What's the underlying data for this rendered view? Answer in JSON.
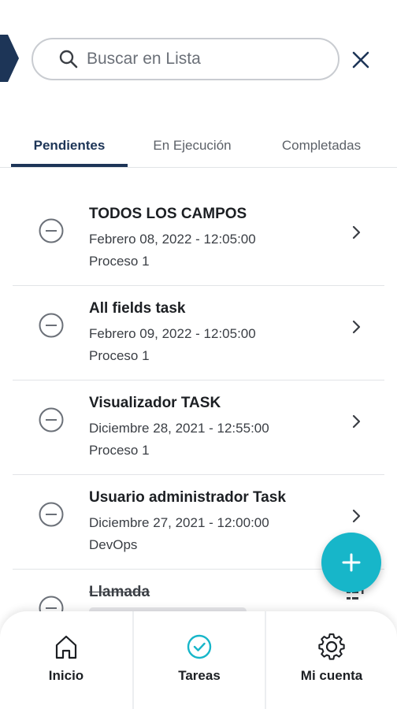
{
  "search": {
    "placeholder": "Buscar en Lista"
  },
  "tabs": [
    {
      "label": "Pendientes",
      "active": true
    },
    {
      "label": "En Ejecución",
      "active": false
    },
    {
      "label": "Completadas",
      "active": false
    }
  ],
  "tasks": [
    {
      "title": "TODOS LOS CAMPOS",
      "date": "Febrero 08, 2022 - 12:05:00",
      "process": "Proceso 1"
    },
    {
      "title": "All fields task",
      "date": "Febrero 09, 2022 - 12:05:00",
      "process": "Proceso 1"
    },
    {
      "title": "Visualizador TASK",
      "date": "Diciembre 28, 2021 - 12:55:00",
      "process": "Proceso 1"
    },
    {
      "title": "Usuario administrador Task",
      "date": "Diciembre 27, 2021 - 12:00:00",
      "process": "DevOps"
    }
  ],
  "partial_task": {
    "title": "Llamada"
  },
  "nav": [
    {
      "label": "Inicio",
      "icon": "home-icon"
    },
    {
      "label": "Tareas",
      "icon": "check-circle-icon"
    },
    {
      "label": "Mi cuenta",
      "icon": "gear-icon"
    }
  ],
  "colors": {
    "primary": "#1d3557",
    "accent": "#17b6c9",
    "divider": "#e2e4e7"
  },
  "icons": {
    "back": "back-tab-icon",
    "search": "search-icon",
    "close": "close-icon",
    "status": "minus-circle-icon",
    "chevron": "chevron-right-icon",
    "fab": "plus-icon",
    "filter": "filter-icon"
  }
}
